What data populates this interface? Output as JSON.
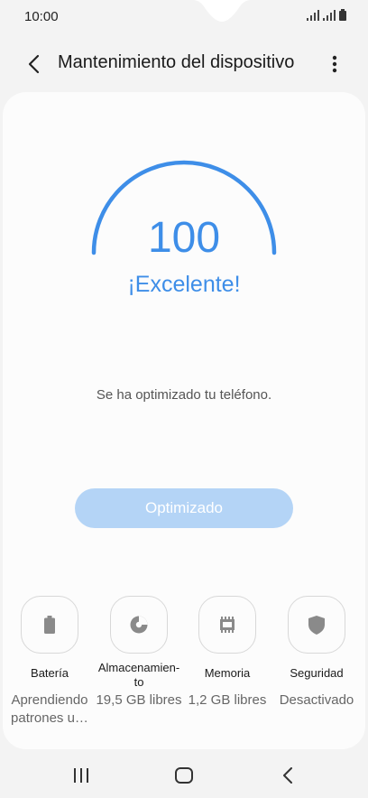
{
  "status_bar": {
    "time": "10:00"
  },
  "app_bar": {
    "title": "Mantenimiento del dispositivo"
  },
  "score": {
    "value": "100",
    "label": "¡Excelente!",
    "gauge_level": 1.0,
    "color": "#3e8ee8"
  },
  "message": "Se ha optimizado tu teléfono.",
  "optimize_button": {
    "label": "Optimizado",
    "color": "#b4d4f6"
  },
  "tiles": [
    {
      "name": "Batería",
      "value": "Aprendiendo patrones u…",
      "icon": "battery-icon"
    },
    {
      "name": "Almacenamien-to",
      "value": "19,5 GB libres",
      "icon": "storage-pie-icon"
    },
    {
      "name": "Memoria",
      "value": "1,2 GB libres",
      "icon": "memory-chip-icon"
    },
    {
      "name": "Seguridad",
      "value": "Desactivado",
      "icon": "shield-icon"
    }
  ],
  "icons": {
    "back": "back-arrow-icon",
    "more": "more-options-icon",
    "recent": "recent-apps-icon",
    "home": "home-icon",
    "nav_back": "nav-back-icon"
  }
}
